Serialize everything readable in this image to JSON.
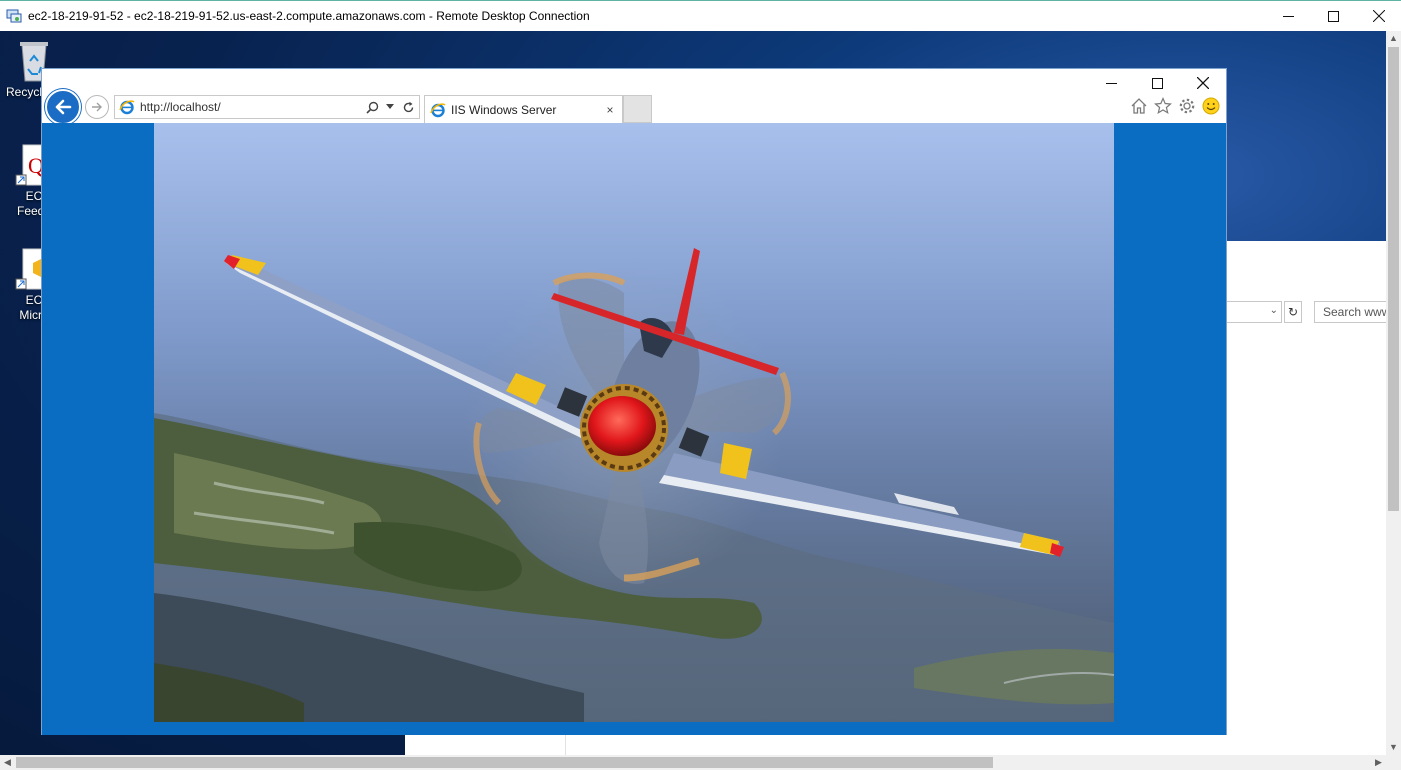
{
  "rdp": {
    "title": "ec2-18-219-91-52 - ec2-18-219-91-52.us-east-2.compute.amazonaws.com - Remote Desktop Connection",
    "controls": {
      "minimize": "—",
      "maximize": "☐",
      "close": "✕"
    }
  },
  "desktop": {
    "icons": [
      {
        "label": "Recycl",
        "icon": "recycle-bin-icon"
      },
      {
        "label": "EC\nFeedb",
        "icon": "feedback-shortcut-icon"
      },
      {
        "label": "EC\nMicro",
        "icon": "package-shortcut-icon"
      }
    ]
  },
  "background_window": {
    "search_placeholder": "Search www",
    "refresh": "↻",
    "dropdown": "⌄"
  },
  "browser": {
    "url": "http://localhost/",
    "tab_title": "IIS Windows Server",
    "tab_close": "×",
    "controls": {
      "minimize": "—",
      "maximize": "☐",
      "close": "✕"
    },
    "content_image": "p51-mustang-airplane-photo",
    "colors": {
      "page_bg": "#0a6dc2",
      "back_button": "#1a6cc4"
    }
  },
  "scrollbars": {
    "up": "▲",
    "down": "▼",
    "left": "◀",
    "right": "▶"
  }
}
